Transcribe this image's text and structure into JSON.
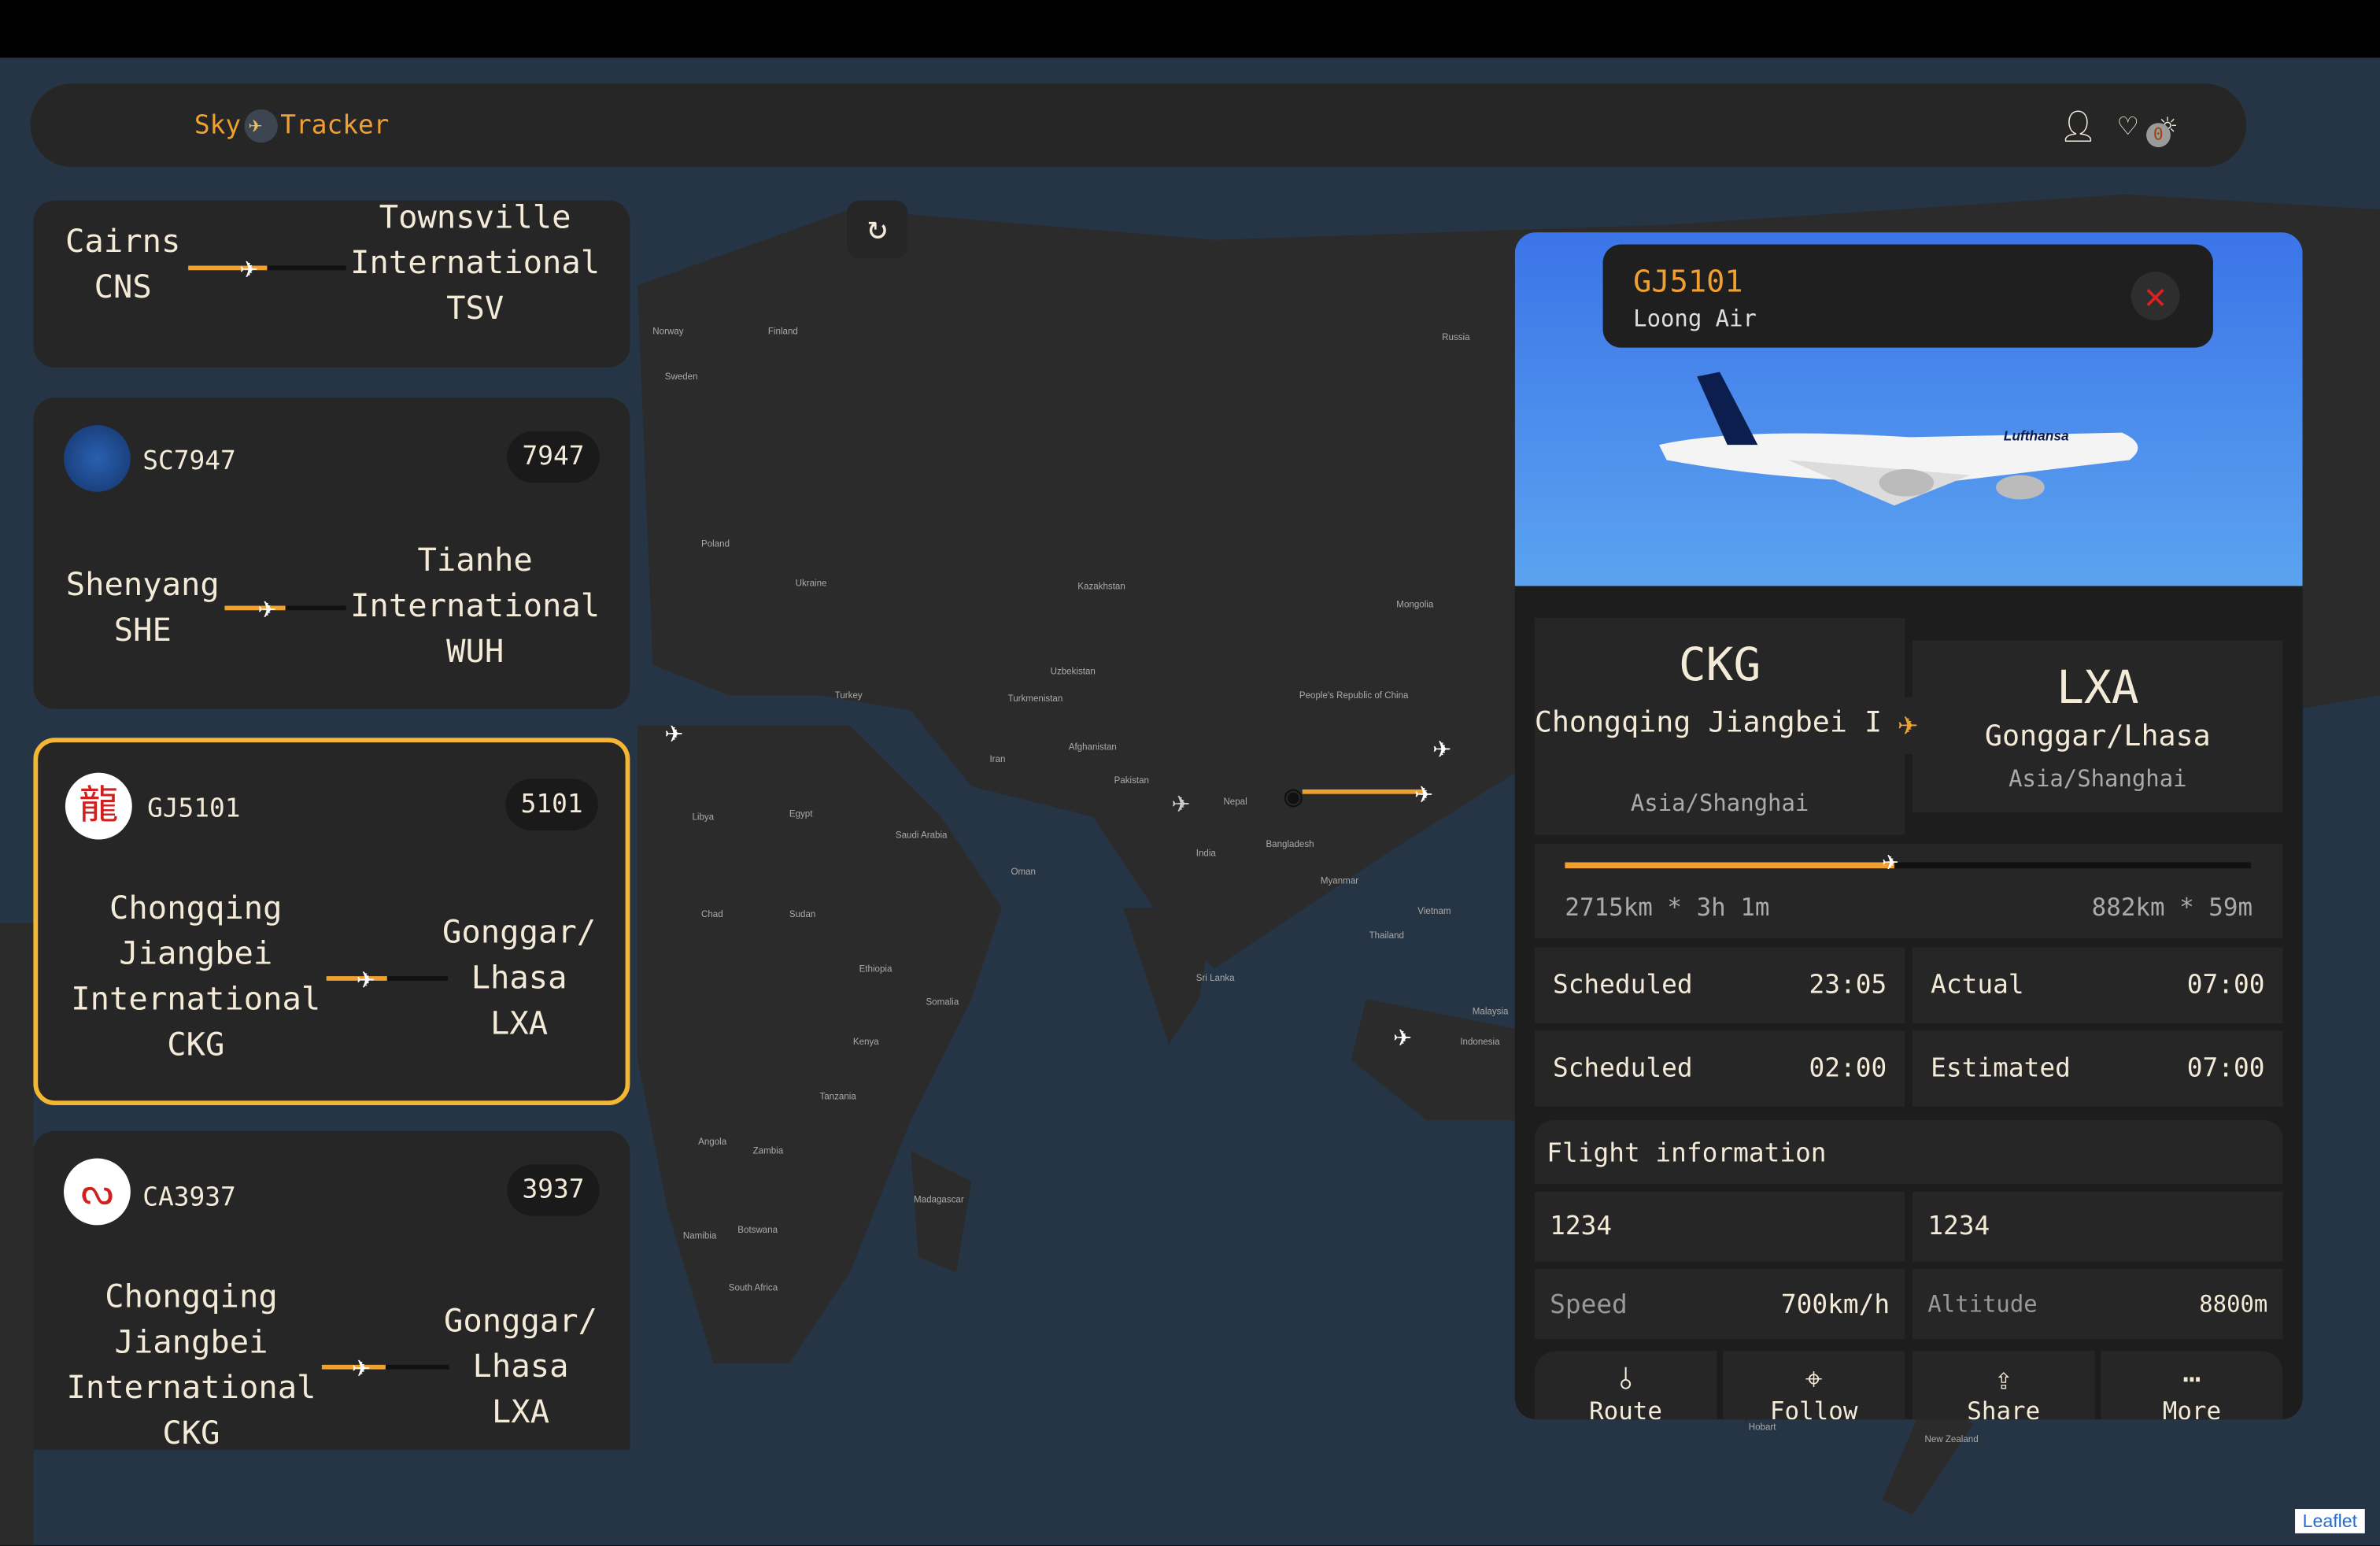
{
  "header": {
    "logo_left": "Sky",
    "logo_right": "Tracker",
    "favorites_count": "0"
  },
  "cards": [
    {
      "from_city": "Cairns",
      "from_code": "CNS",
      "to_city": "Townsville International",
      "to_code": "TSV"
    },
    {
      "flight": "SC7947",
      "number": "7947",
      "from_city": "Shenyang",
      "from_code": "SHE",
      "to_city": "Tianhe International",
      "to_code": "WUH"
    },
    {
      "flight": "GJ5101",
      "number": "5101",
      "from_city": "Chongqing Jiangbei International",
      "from_code": "CKG",
      "to_city": "Gonggar/ Lhasa",
      "to_code": "LXA"
    },
    {
      "flight": "CA3937",
      "number": "3937",
      "from_city": "Chongqing Jiangbei International",
      "from_code": "CKG",
      "to_city": "Gonggar/ Lhasa",
      "to_code": "LXA"
    }
  ],
  "detail": {
    "flight": "GJ5101",
    "airline": "Loong Air",
    "livery": "Lufthansa",
    "from_code": "CKG",
    "from_name": "Chongqing Jiangbei International",
    "from_tz": "Asia/Shanghai",
    "to_code": "LXA",
    "to_name": "Gonggar/Lhasa",
    "to_tz": "Asia/Shanghai",
    "progress": 0.48,
    "elapsed": "2715km * 3h 1m",
    "remaining": "882km * 59m",
    "times": [
      {
        "label": "Scheduled",
        "value": "23:05"
      },
      {
        "label": "Actual",
        "value": "07:00"
      },
      {
        "label": "Scheduled",
        "value": "02:00"
      },
      {
        "label": "Estimated",
        "value": "07:00"
      }
    ],
    "info_title": "Flight information",
    "info_a": "1234",
    "info_b": "1234",
    "speed_label": "Speed",
    "speed": "700km/h",
    "altitude_label": "Altitude",
    "altitude": "8800m",
    "actions": [
      "Route",
      "Follow",
      "Share",
      "More"
    ]
  },
  "map": {
    "labels": [
      "Norway",
      "Sweden",
      "Finland",
      "Russia",
      "Poland",
      "Ukraine",
      "Kazakhstan",
      "Mongolia",
      "Turkey",
      "Iran",
      "Egypt",
      "Libya",
      "Sudan",
      "Chad",
      "Saudi Arabia",
      "India",
      "Pakistan",
      "Afghanistan",
      "Nepal",
      "Bangladesh",
      "Myanmar",
      "Thailand",
      "Vietnam",
      "Malaysia",
      "Indonesia",
      "Kenya",
      "Tanzania",
      "Angola",
      "Zambia",
      "Namibia",
      "Botswana",
      "South Africa",
      "Madagascar",
      "Ethiopia",
      "Somalia",
      "Oman",
      "Sri Lanka",
      "Uzbekistan",
      "Turkmenistan",
      "People's Republic of China",
      "Hobart",
      "New Zealand"
    ],
    "attribution": "Leaflet"
  }
}
